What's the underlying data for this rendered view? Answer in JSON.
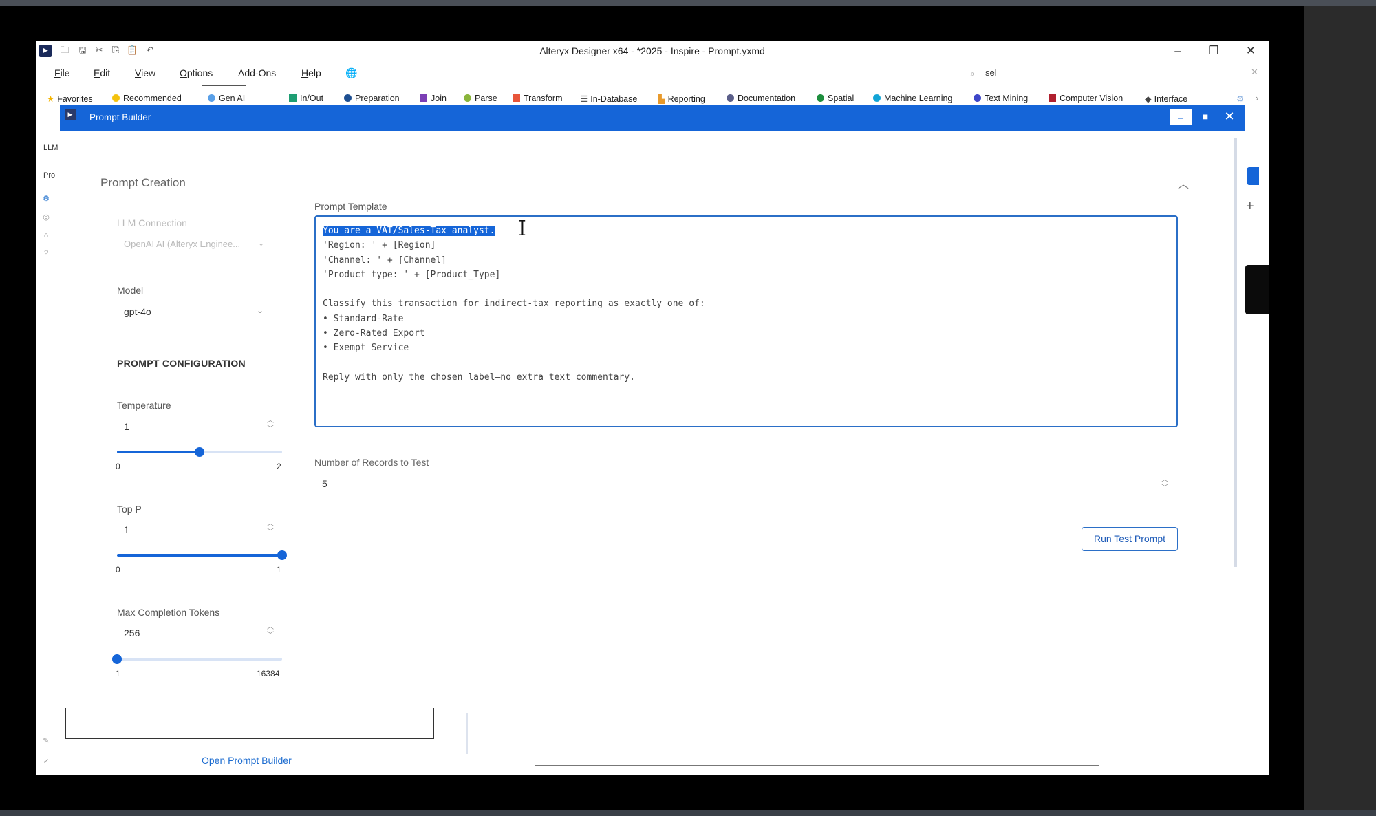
{
  "window": {
    "title": "Alteryx Designer x64 - *2025 - Inspire - Prompt.yxmd",
    "min_label": "–",
    "restore_label": "❐",
    "close_label": "✕"
  },
  "menu": {
    "items": [
      "File",
      "Edit",
      "View",
      "Options",
      "Add-Ons",
      "Help"
    ],
    "globe": "🌐"
  },
  "search": {
    "value": "sel",
    "clear": "✕"
  },
  "toolbar": {
    "categories": [
      {
        "label": "Favorites",
        "color": "#f4b400"
      },
      {
        "label": "Recommended",
        "color": "#f4c20d"
      },
      {
        "label": "Gen AI",
        "color": "#5aa0e8"
      },
      {
        "label": "In/Out",
        "color": "#1e9e73"
      },
      {
        "label": "Preparation",
        "color": "#1d4f91"
      },
      {
        "label": "Join",
        "color": "#7b3fb5"
      },
      {
        "label": "Parse",
        "color": "#8ab53b"
      },
      {
        "label": "Transform",
        "color": "#e8553a"
      },
      {
        "label": "In-Database",
        "color": "#555555"
      },
      {
        "label": "Reporting",
        "color": "#e89a2c"
      },
      {
        "label": "Documentation",
        "color": "#5b5f8a"
      },
      {
        "label": "Spatial",
        "color": "#1e8e3e"
      },
      {
        "label": "Machine Learning",
        "color": "#12a4d6"
      },
      {
        "label": "Text Mining",
        "color": "#3d46c8"
      },
      {
        "label": "Computer Vision",
        "color": "#b0202f"
      },
      {
        "label": "Interface",
        "color": "#444444"
      }
    ]
  },
  "dialog": {
    "title": "Prompt Builder",
    "nav": {
      "llm": "LLM",
      "pro": "Pro"
    },
    "section_title": "Prompt Creation",
    "llm_connection": {
      "label": "LLM Connection",
      "value": "OpenAI AI (Alteryx Enginee..."
    },
    "model": {
      "label": "Model",
      "value": "gpt-4o"
    },
    "config_heading": "PROMPT CONFIGURATION",
    "temperature": {
      "label": "Temperature",
      "value": "1",
      "min": "0",
      "max": "2",
      "level": 0.5
    },
    "top_p": {
      "label": "Top P",
      "value": "1",
      "min": "0",
      "max": "1",
      "level": 1.0
    },
    "max_tokens": {
      "label": "Max Completion Tokens",
      "value": "256",
      "min": "1",
      "max": "16384",
      "level": 0.0
    },
    "prompt_template": {
      "label": "Prompt Template",
      "selected_line": "You are a VAT/Sales-Tax analyst.",
      "rest": "\n'Region: ' + [Region]\n'Channel: ' + [Channel]\n'Product type: ' + [Product_Type]\n\nClassify this transaction for indirect-tax reporting as exactly one of:\n• Standard-Rate\n• Zero-Rated Export\n• Exempt Service\n\nReply with only the chosen label—no extra text commentary."
    },
    "records": {
      "label": "Number of Records to Test",
      "value": "5"
    },
    "run_button": "Run Test Prompt",
    "open_link": "Open Prompt Builder"
  },
  "colors": {
    "accent": "#1565d8",
    "header": "#1565d8"
  }
}
